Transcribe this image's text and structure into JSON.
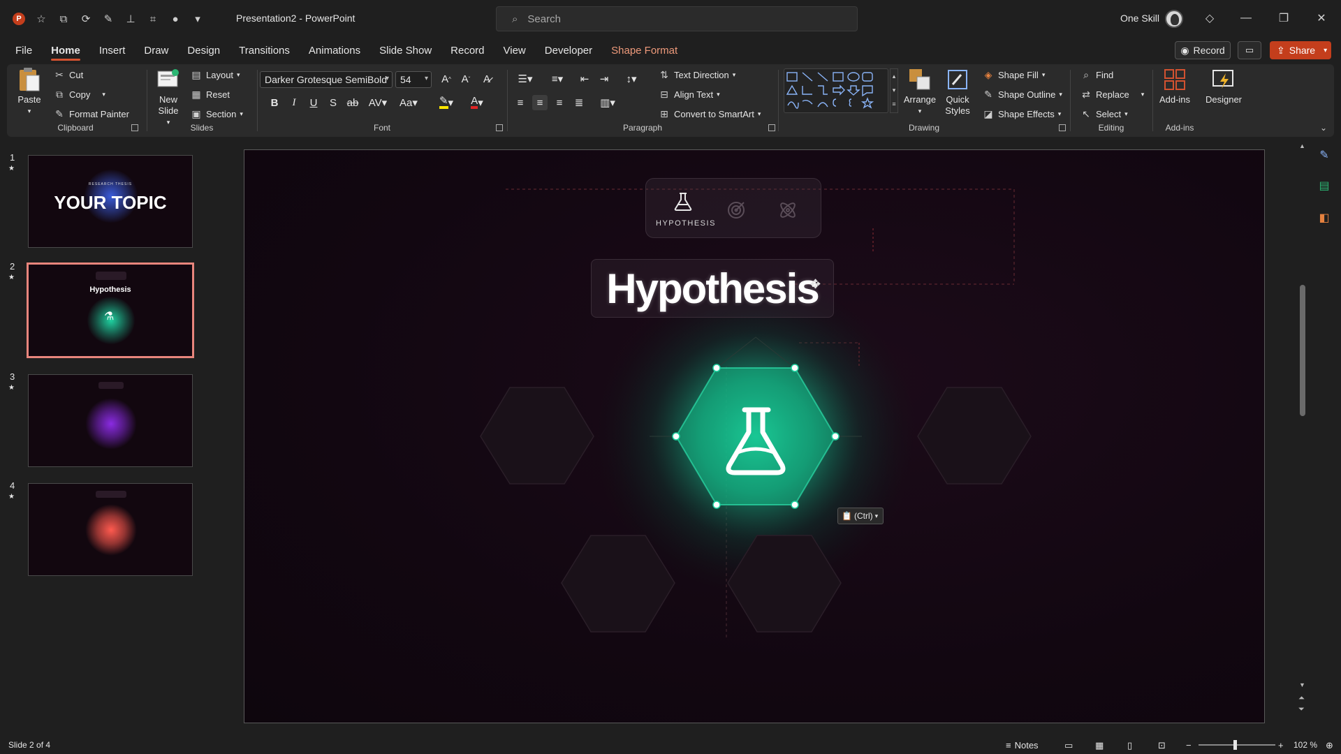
{
  "window": {
    "title": "Presentation2  -  PowerPoint",
    "search_placeholder": "Search",
    "user": "One Skill"
  },
  "menu": {
    "tabs": [
      "File",
      "Home",
      "Insert",
      "Draw",
      "Design",
      "Transitions",
      "Animations",
      "Slide Show",
      "Record",
      "View",
      "Developer",
      "Shape Format"
    ],
    "active": "Home",
    "record_label": "Record",
    "share_label": "Share"
  },
  "ribbon": {
    "clipboard": {
      "label": "Clipboard",
      "paste": "Paste",
      "cut": "Cut",
      "copy": "Copy",
      "format_painter": "Format Painter"
    },
    "slides": {
      "label": "Slides",
      "new_slide": "New Slide",
      "layout": "Layout",
      "reset": "Reset",
      "section": "Section"
    },
    "font": {
      "label": "Font",
      "family": "Darker Grotesque SemiBold",
      "size": "54"
    },
    "paragraph": {
      "label": "Paragraph",
      "text_direction": "Text Direction",
      "align_text": "Align Text",
      "convert_smartart": "Convert to SmartArt"
    },
    "drawing": {
      "label": "Drawing",
      "arrange": "Arrange",
      "quick_styles": "Quick Styles",
      "shape_fill": "Shape Fill",
      "shape_outline": "Shape Outline",
      "shape_effects": "Shape Effects"
    },
    "editing": {
      "label": "Editing",
      "find": "Find",
      "replace": "Replace",
      "select": "Select"
    },
    "addins": {
      "label": "Add-ins",
      "addins_btn": "Add-ins",
      "designer": "Designer"
    }
  },
  "thumbnails": [
    {
      "num": "1",
      "text_title": "YOUR TOPIC",
      "text_sub": "RESEARCH THESIS",
      "glow": "#3a5bd9"
    },
    {
      "num": "2",
      "text_title": "Hypothesis",
      "glow": "#1fd1a0",
      "selected": true
    },
    {
      "num": "3",
      "glow": "#8a2be2"
    },
    {
      "num": "4",
      "glow": "#ff5a4f"
    }
  ],
  "slide": {
    "title": "Hypothesis",
    "nav_label": "HYPOTHESIS",
    "paste_tag": "(Ctrl)",
    "accent": "#1fd1a0"
  },
  "status": {
    "slide_info": "Slide 2 of 4",
    "notes": "Notes",
    "zoom": "102 %"
  }
}
